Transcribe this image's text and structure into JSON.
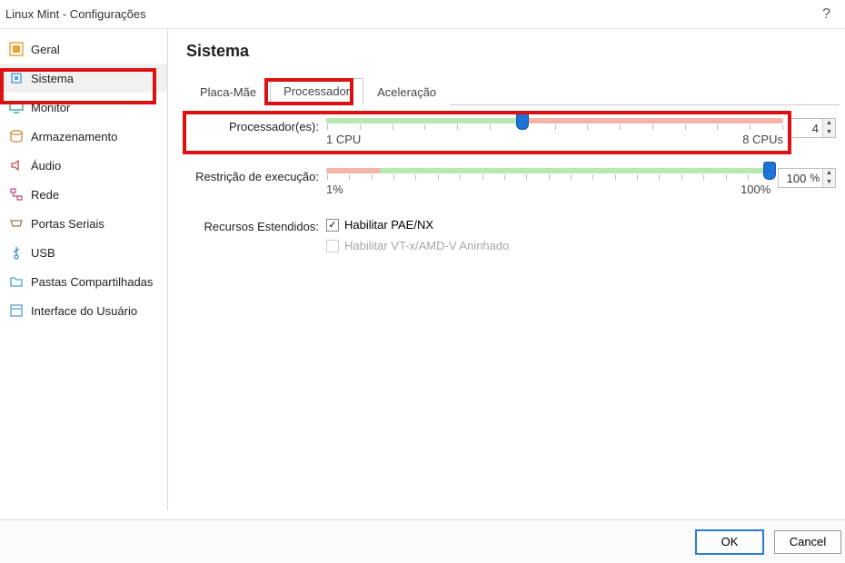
{
  "window": {
    "title": "Linux Mint - Configurações",
    "help": "?"
  },
  "sidebar": {
    "items": [
      {
        "label": "Geral"
      },
      {
        "label": "Sistema"
      },
      {
        "label": "Monitor"
      },
      {
        "label": "Armazenamento"
      },
      {
        "label": "Áudio"
      },
      {
        "label": "Rede"
      },
      {
        "label": "Portas Seriais"
      },
      {
        "label": "USB"
      },
      {
        "label": "Pastas Compartilhadas"
      },
      {
        "label": "Interface do Usuário"
      }
    ],
    "selected_index": 1
  },
  "page": {
    "title": "Sistema"
  },
  "tabs": {
    "items": [
      {
        "label": "Placa-Mãe"
      },
      {
        "label": "Processador"
      },
      {
        "label": "Aceleração"
      }
    ],
    "active_index": 1
  },
  "processor": {
    "label": "Processador(es):",
    "min_label": "1 CPU",
    "max_label": "8 CPUs",
    "value": "4",
    "slider_percent": 43,
    "green_end_pct": 43,
    "red_start_pct": 43
  },
  "exec_cap": {
    "label": "Restrição de execução:",
    "min_label": "1%",
    "max_label": "100%",
    "value": "100",
    "suffix": "%",
    "slider_percent": 100,
    "red_end_pct": 12,
    "green_start_pct": 12
  },
  "extended": {
    "label": "Recursos Estendidos:",
    "pae": {
      "label": "Habilitar PAE/NX",
      "checked": true
    },
    "nested": {
      "label": "Habilitar VT-x/AMD-V Aninhado",
      "checked": false,
      "disabled": true
    }
  },
  "footer": {
    "ok": "OK",
    "cancel": "Cancel"
  }
}
